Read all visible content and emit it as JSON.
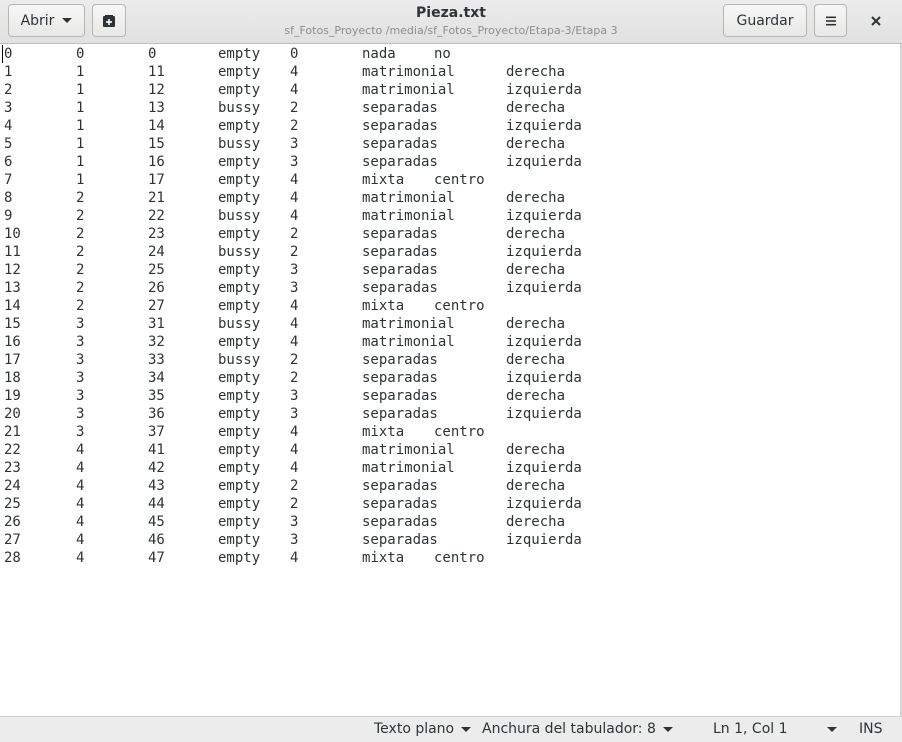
{
  "header": {
    "open_label": "Abrir",
    "new_tab_icon": "new-document-icon",
    "title": "Pieza.txt",
    "subtitle": "sf_Fotos_Proyecto /media/sf_Fotos_Proyecto/Etapa-3/Etapa 3",
    "save_label": "Guardar",
    "menu_icon": "hamburger-menu-icon",
    "close_icon": "close-icon"
  },
  "editor": {
    "rows": [
      [
        "0",
        "0",
        "0",
        "empty",
        "0",
        "nada",
        "no",
        ""
      ],
      [
        "1",
        "1",
        "11",
        "empty",
        "4",
        "matrimonial",
        "",
        "derecha"
      ],
      [
        "2",
        "1",
        "12",
        "empty",
        "4",
        "matrimonial",
        "",
        "izquierda"
      ],
      [
        "3",
        "1",
        "13",
        "bussy",
        "2",
        "separadas",
        "",
        "derecha"
      ],
      [
        "4",
        "1",
        "14",
        "empty",
        "2",
        "separadas",
        "",
        "izquierda"
      ],
      [
        "5",
        "1",
        "15",
        "bussy",
        "3",
        "separadas",
        "",
        "derecha"
      ],
      [
        "6",
        "1",
        "16",
        "empty",
        "3",
        "separadas",
        "",
        "izquierda"
      ],
      [
        "7",
        "1",
        "17",
        "empty",
        "4",
        "mixta",
        "centro",
        ""
      ],
      [
        "8",
        "2",
        "21",
        "empty",
        "4",
        "matrimonial",
        "",
        "derecha"
      ],
      [
        "9",
        "2",
        "22",
        "bussy",
        "4",
        "matrimonial",
        "",
        "izquierda"
      ],
      [
        "10",
        "2",
        "23",
        "empty",
        "2",
        "separadas",
        "",
        "derecha"
      ],
      [
        "11",
        "2",
        "24",
        "bussy",
        "2",
        "separadas",
        "",
        "izquierda"
      ],
      [
        "12",
        "2",
        "25",
        "empty",
        "3",
        "separadas",
        "",
        "derecha"
      ],
      [
        "13",
        "2",
        "26",
        "empty",
        "3",
        "separadas",
        "",
        "izquierda"
      ],
      [
        "14",
        "2",
        "27",
        "empty",
        "4",
        "mixta",
        "centro",
        ""
      ],
      [
        "15",
        "3",
        "31",
        "bussy",
        "4",
        "matrimonial",
        "",
        "derecha"
      ],
      [
        "16",
        "3",
        "32",
        "empty",
        "4",
        "matrimonial",
        "",
        "izquierda"
      ],
      [
        "17",
        "3",
        "33",
        "bussy",
        "2",
        "separadas",
        "",
        "derecha"
      ],
      [
        "18",
        "3",
        "34",
        "empty",
        "2",
        "separadas",
        "",
        "izquierda"
      ],
      [
        "19",
        "3",
        "35",
        "empty",
        "3",
        "separadas",
        "",
        "derecha"
      ],
      [
        "20",
        "3",
        "36",
        "empty",
        "3",
        "separadas",
        "",
        "izquierda"
      ],
      [
        "21",
        "3",
        "37",
        "empty",
        "4",
        "mixta",
        "centro",
        ""
      ],
      [
        "22",
        "4",
        "41",
        "empty",
        "4",
        "matrimonial",
        "",
        "derecha"
      ],
      [
        "23",
        "4",
        "42",
        "empty",
        "4",
        "matrimonial",
        "",
        "izquierda"
      ],
      [
        "24",
        "4",
        "43",
        "empty",
        "2",
        "separadas",
        "",
        "derecha"
      ],
      [
        "25",
        "4",
        "44",
        "empty",
        "2",
        "separadas",
        "",
        "izquierda"
      ],
      [
        "26",
        "4",
        "45",
        "empty",
        "3",
        "separadas",
        "",
        "derecha"
      ],
      [
        "27",
        "4",
        "46",
        "empty",
        "3",
        "separadas",
        "",
        "izquierda"
      ],
      [
        "28",
        "4",
        "47",
        "empty",
        "4",
        "mixta",
        "centro",
        ""
      ]
    ]
  },
  "statusbar": {
    "language": "Texto plano",
    "tab_width": "Anchura del tabulador: 8",
    "position": "Ln 1, Col 1",
    "mode": "INS"
  }
}
